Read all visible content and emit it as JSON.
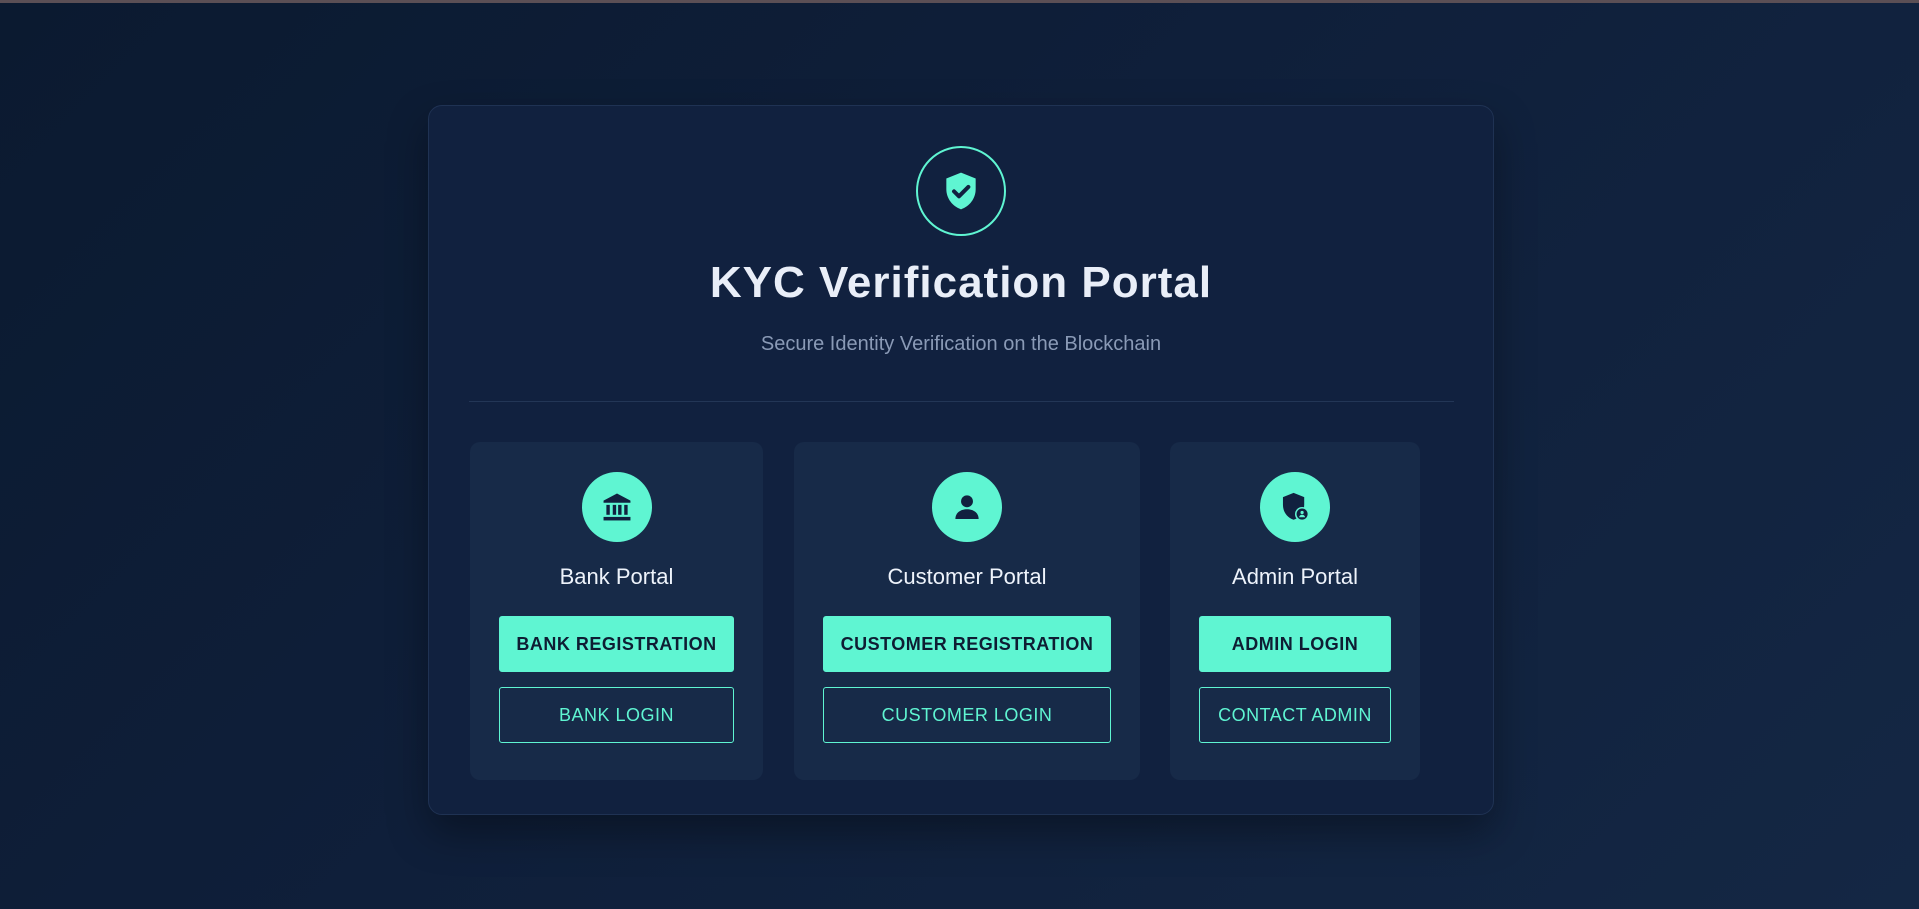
{
  "header": {
    "title": "KYC Verification Portal",
    "subtitle": "Secure Identity Verification on the Blockchain",
    "logo_icon": "shield-check-icon"
  },
  "portals": [
    {
      "name": "Bank Portal",
      "icon": "bank-icon",
      "primary_label": "BANK REGISTRATION",
      "secondary_label": "BANK LOGIN"
    },
    {
      "name": "Customer Portal",
      "icon": "user-icon",
      "primary_label": "CUSTOMER REGISTRATION",
      "secondary_label": "CUSTOMER LOGIN"
    },
    {
      "name": "Admin Portal",
      "icon": "admin-shield-icon",
      "primary_label": "ADMIN LOGIN",
      "secondary_label": "CONTACT ADMIN"
    }
  ],
  "colors": {
    "accent": "#5ff5d2",
    "background": "#0f1f3a",
    "card": "#11213f",
    "portal_card": "#172a48",
    "title_text": "#e9eef8",
    "subtitle_text": "#8a9ab6"
  }
}
